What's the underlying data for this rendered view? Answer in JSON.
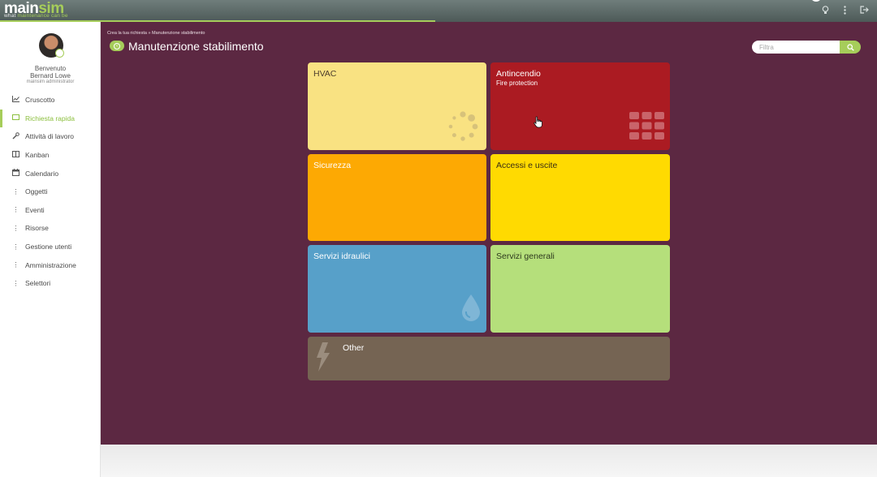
{
  "app": {
    "logo_main": "main",
    "logo_accent": "sim",
    "tagline_prefix": "what ",
    "tagline_rest": "maintenance can be",
    "accent_color": "#a6cd5a",
    "background_color": "#5c2842"
  },
  "user": {
    "greeting": "Benvenuto",
    "name": "Bernard Lowe",
    "role": "mainsim administrator"
  },
  "sidebar": {
    "items": [
      {
        "label": "Cruscotto",
        "icon": "chart-icon",
        "active": false
      },
      {
        "label": "Richiesta rapida",
        "icon": "screen-icon",
        "active": true
      },
      {
        "label": "Attività di lavoro",
        "icon": "wrench-icon",
        "active": false
      },
      {
        "label": "Kanban",
        "icon": "board-icon",
        "active": false
      },
      {
        "label": "Calendario",
        "icon": "calendar-icon",
        "active": false
      },
      {
        "label": "Oggetti",
        "icon": "dots-icon",
        "active": false
      },
      {
        "label": "Eventi",
        "icon": "dots-icon",
        "active": false
      },
      {
        "label": "Risorse",
        "icon": "dots-icon",
        "active": false
      },
      {
        "label": "Gestione utenti",
        "icon": "dots-icon",
        "active": false
      },
      {
        "label": "Amministrazione",
        "icon": "dots-icon",
        "active": false
      },
      {
        "label": "Selettori",
        "icon": "dots-icon",
        "active": false
      }
    ]
  },
  "header": {
    "breadcrumb": "Crea la tua richiesta  »  Manutenzione stabilimento",
    "title": "Manutenzione stabilimento",
    "filter_placeholder": "Filtra"
  },
  "tiles": {
    "hvac": {
      "title": "HVAC",
      "color": "#f9e282",
      "icon": "spinner-icon"
    },
    "fire": {
      "title": "Antincendio",
      "subtitle": "Fire protection",
      "color": "#ab1b22",
      "icon": "grid-icon"
    },
    "security": {
      "title": "Sicurezza",
      "color": "#fda903"
    },
    "access": {
      "title": "Accessi e uscite",
      "color": "#ffda01"
    },
    "water": {
      "title": "Servizi idraulici",
      "color": "#57a0c9",
      "icon": "water-drop-icon"
    },
    "general": {
      "title": "Servizi generali",
      "color": "#b5df7b"
    },
    "other": {
      "title": "Other",
      "color": "#756453",
      "icon": "lightning-icon"
    }
  }
}
